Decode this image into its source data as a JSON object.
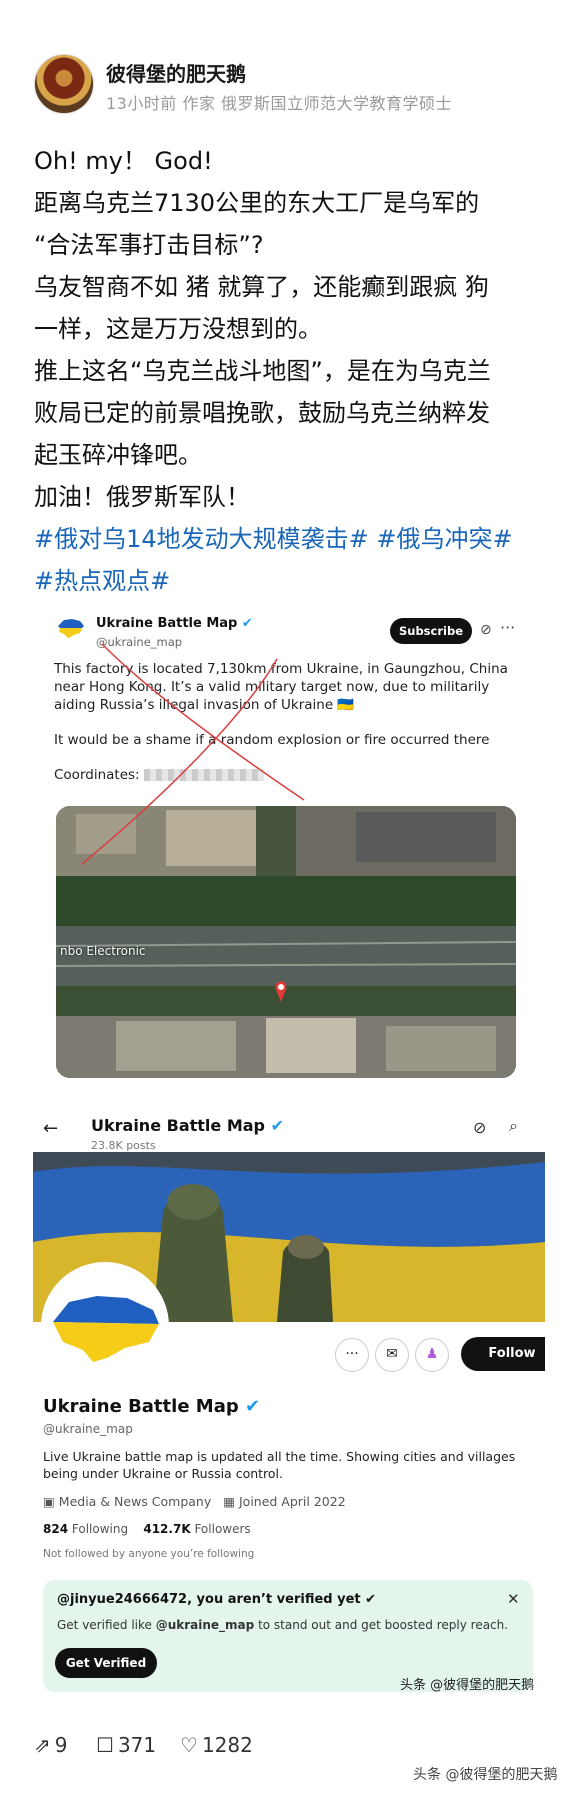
{
  "author": {
    "name": "彼得堡的肥天鹅",
    "meta": "13小时前 作家 俄罗斯国立师范大学教育学硕士"
  },
  "post": {
    "lines": [
      "Oh!   my！ God!",
      "距离乌克兰7130公里的东大工厂是乌军的",
      "“合法军事打击目标”?",
      "乌友智商不如 猪 就算了，还能癫到跟疯 狗",
      "一样，这是万万没想到的。",
      "推上这名“乌克兰战斗地图”，是在为乌克兰",
      "败局已定的前景唱挽歌，鼓励乌克兰纳粹发",
      "起玉碎冲锋吧。",
      "加油！俄罗斯军队！"
    ],
    "hashtags_line1": "#俄对乌14地发动大规模袭击# #俄乌冲突#",
    "hashtags_line2": "#热点观点#"
  },
  "tweet": {
    "name": "Ukraine Battle Map",
    "handle": "@ukraine_map",
    "subscribe": "Subscribe",
    "text1": "This factory is located 7,130km from Ukraine, in Gaungzhou, China near Hong Kong. It’s a valid military target now, due to militarily aiding Russia’s illegal invasion of Ukraine 🇺🇦",
    "text2": "It would be a shame if a random explosion or fire occurred there",
    "coords_label": "Coordinates:",
    "map_label": "nbo Electronic"
  },
  "profile": {
    "name": "Ukraine Battle Map",
    "posts": "23.8K posts",
    "handle": "@ukraine_map",
    "follow": "Follow",
    "bio": "Live Ukraine battle map is updated all the time. Showing cities and villages being under Ukraine or Russia control.",
    "category": "Media & News Company",
    "joined": "Joined April 2022",
    "following_count": "824",
    "following_label": "Following",
    "followers_count": "412.7K",
    "followers_label": "Followers",
    "not_followed": "Not followed by anyone you’re following",
    "verify_title": "@jinyue24666472, you aren’t verified yet",
    "verify_text_a": "Get verified like ",
    "verify_text_handle": "@ukraine_map",
    "verify_text_b": " to stand out and get boosted reply reach.",
    "verify_button": "Get Verified"
  },
  "watermark_image": "头条 @彼得堡的肥天鹅",
  "actions": {
    "share": "9",
    "comments": "371",
    "likes": "1282"
  },
  "watermark_bottom": "头条 @彼得堡的肥天鹅",
  "colors": {
    "hashtag": "#1a67b9",
    "verify_bg": "#e4f5ec",
    "verified": "#1d9bf0"
  }
}
